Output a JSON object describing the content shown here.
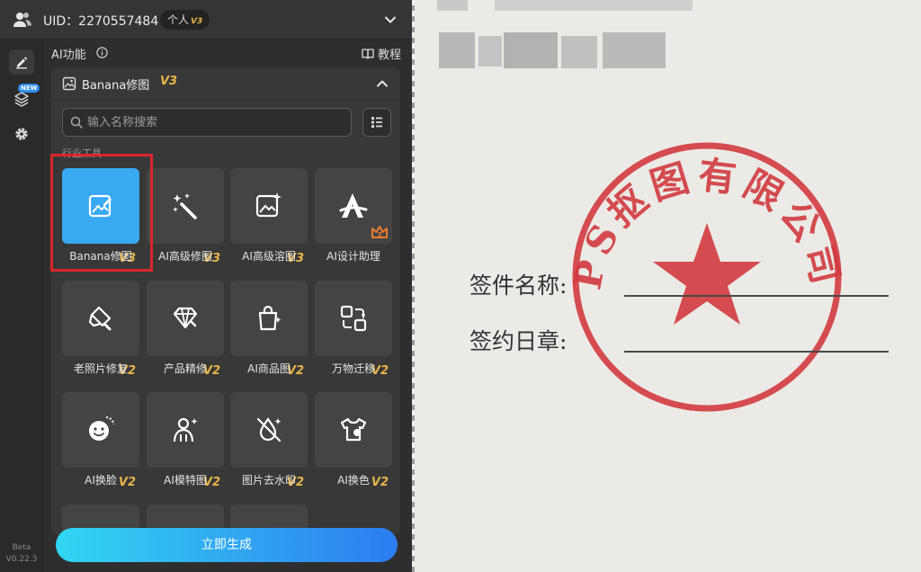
{
  "header": {
    "uid_label": "UID：2270557484",
    "plan_label": "个人",
    "plan_version": "V3"
  },
  "sidebar": {
    "new_badge": "NEW",
    "beta_label": "Beta",
    "version_label": "V0.22.3"
  },
  "ai_section": {
    "title": "AI功能",
    "tutorial_label": "教程"
  },
  "tool_panel": {
    "title": "Banana修图",
    "version": "V3",
    "search_placeholder": "输入名称搜索",
    "category_label": "行业工具",
    "tools": [
      {
        "label": "Banana修图",
        "version": "V3",
        "icon": "image-edit-icon",
        "selected": true
      },
      {
        "label": "AI高级修图",
        "version": "V3",
        "icon": "magic-wand-icon"
      },
      {
        "label": "AI高级溶图",
        "version": "V3",
        "icon": "image-sparkle-icon"
      },
      {
        "label": "AI设计助理",
        "version": "",
        "icon": "design-assistant-icon",
        "badge": "crown-icon"
      },
      {
        "label": "老照片修复",
        "version": "V2",
        "icon": "photo-repair-icon"
      },
      {
        "label": "产品精修",
        "version": "V2",
        "icon": "diamond-icon"
      },
      {
        "label": "AI商品图",
        "version": "V2",
        "icon": "shopping-bag-icon"
      },
      {
        "label": "万物迁移",
        "version": "V2",
        "icon": "transfer-icon"
      },
      {
        "label": "AI换脸",
        "version": "V2",
        "icon": "face-swap-icon"
      },
      {
        "label": "AI模特图",
        "version": "V2",
        "icon": "model-icon"
      },
      {
        "label": "图片去水印",
        "version": "V2",
        "icon": "remove-watermark-icon"
      },
      {
        "label": "AI换色",
        "version": "V2",
        "icon": "recolor-shirt-icon"
      }
    ],
    "generate_label": "立即生成"
  },
  "document": {
    "seal_text": "PS抠图有限公司",
    "field_1": "签件名称:",
    "field_2": "签约日章:"
  },
  "colors": {
    "accent_blue": "#39a9f2",
    "version_gold": "#e8b54a",
    "selection_red": "#d9262b",
    "seal_red": "#d23a3f"
  }
}
